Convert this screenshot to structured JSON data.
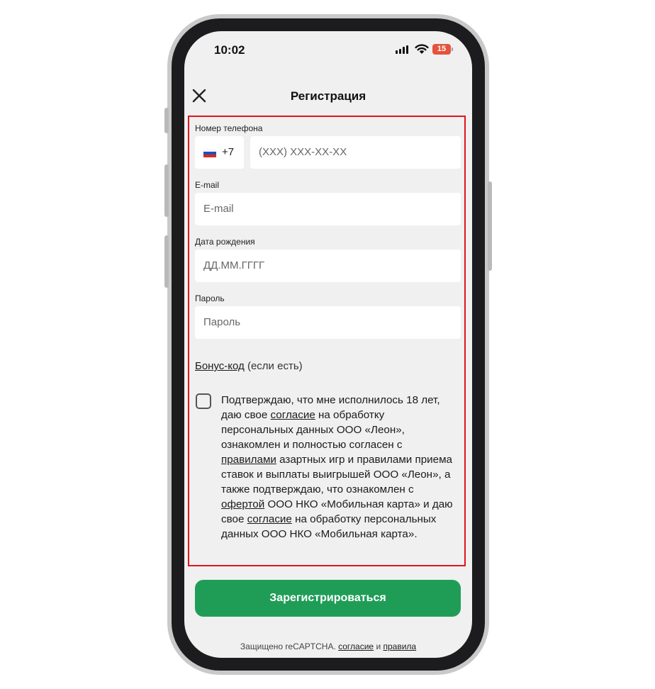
{
  "status_bar": {
    "time": "10:02",
    "battery": "15",
    "icons": [
      "signal-icon",
      "wifi-icon",
      "battery-icon"
    ]
  },
  "header": {
    "title": "Регистрация",
    "close_icon": "close-icon"
  },
  "form": {
    "phone": {
      "label": "Номер телефона",
      "country_code": "+7",
      "flag": "russia-flag-icon",
      "placeholder": "(XXX) XXX-XX-XX"
    },
    "email": {
      "label": "E-mail",
      "placeholder": "E-mail"
    },
    "birthdate": {
      "label": "Дата рождения",
      "placeholder": "ДД.ММ.ГГГГ"
    },
    "password": {
      "label": "Пароль",
      "placeholder": "Пароль"
    },
    "bonus": {
      "link": "Бонус-код",
      "suffix": "(если есть)"
    },
    "consent": {
      "t1": "Подтверждаю, что мне исполнилось 18 лет, даю свое ",
      "l1": "согласие",
      "t2": " на обработку персональных данных ООО «Леон», ознакомлен и полностью согласен с ",
      "l2": "правилами",
      "t3": " азартных игр и правилами приема ставок и выплаты выигрышей ООО «Леон», а также подтверждаю, что ознакомлен с ",
      "l3": "офертой",
      "t4": " ООО НКО «Мобильная карта» и даю свое ",
      "l4": "согласие",
      "t5": " на обработку персональных данных ООО НКО «Мобильная карта»."
    }
  },
  "submit_label": "Зарегистрироваться",
  "footer": {
    "prefix": "Защищено reCAPTCHA. ",
    "link1": "согласие",
    "and": " и ",
    "link2": "правила"
  },
  "colors": {
    "accent_green": "#1f9d57",
    "highlight_red": "#e0141e",
    "screen_bg": "#f0f0f0",
    "battery_red": "#e5533d"
  }
}
